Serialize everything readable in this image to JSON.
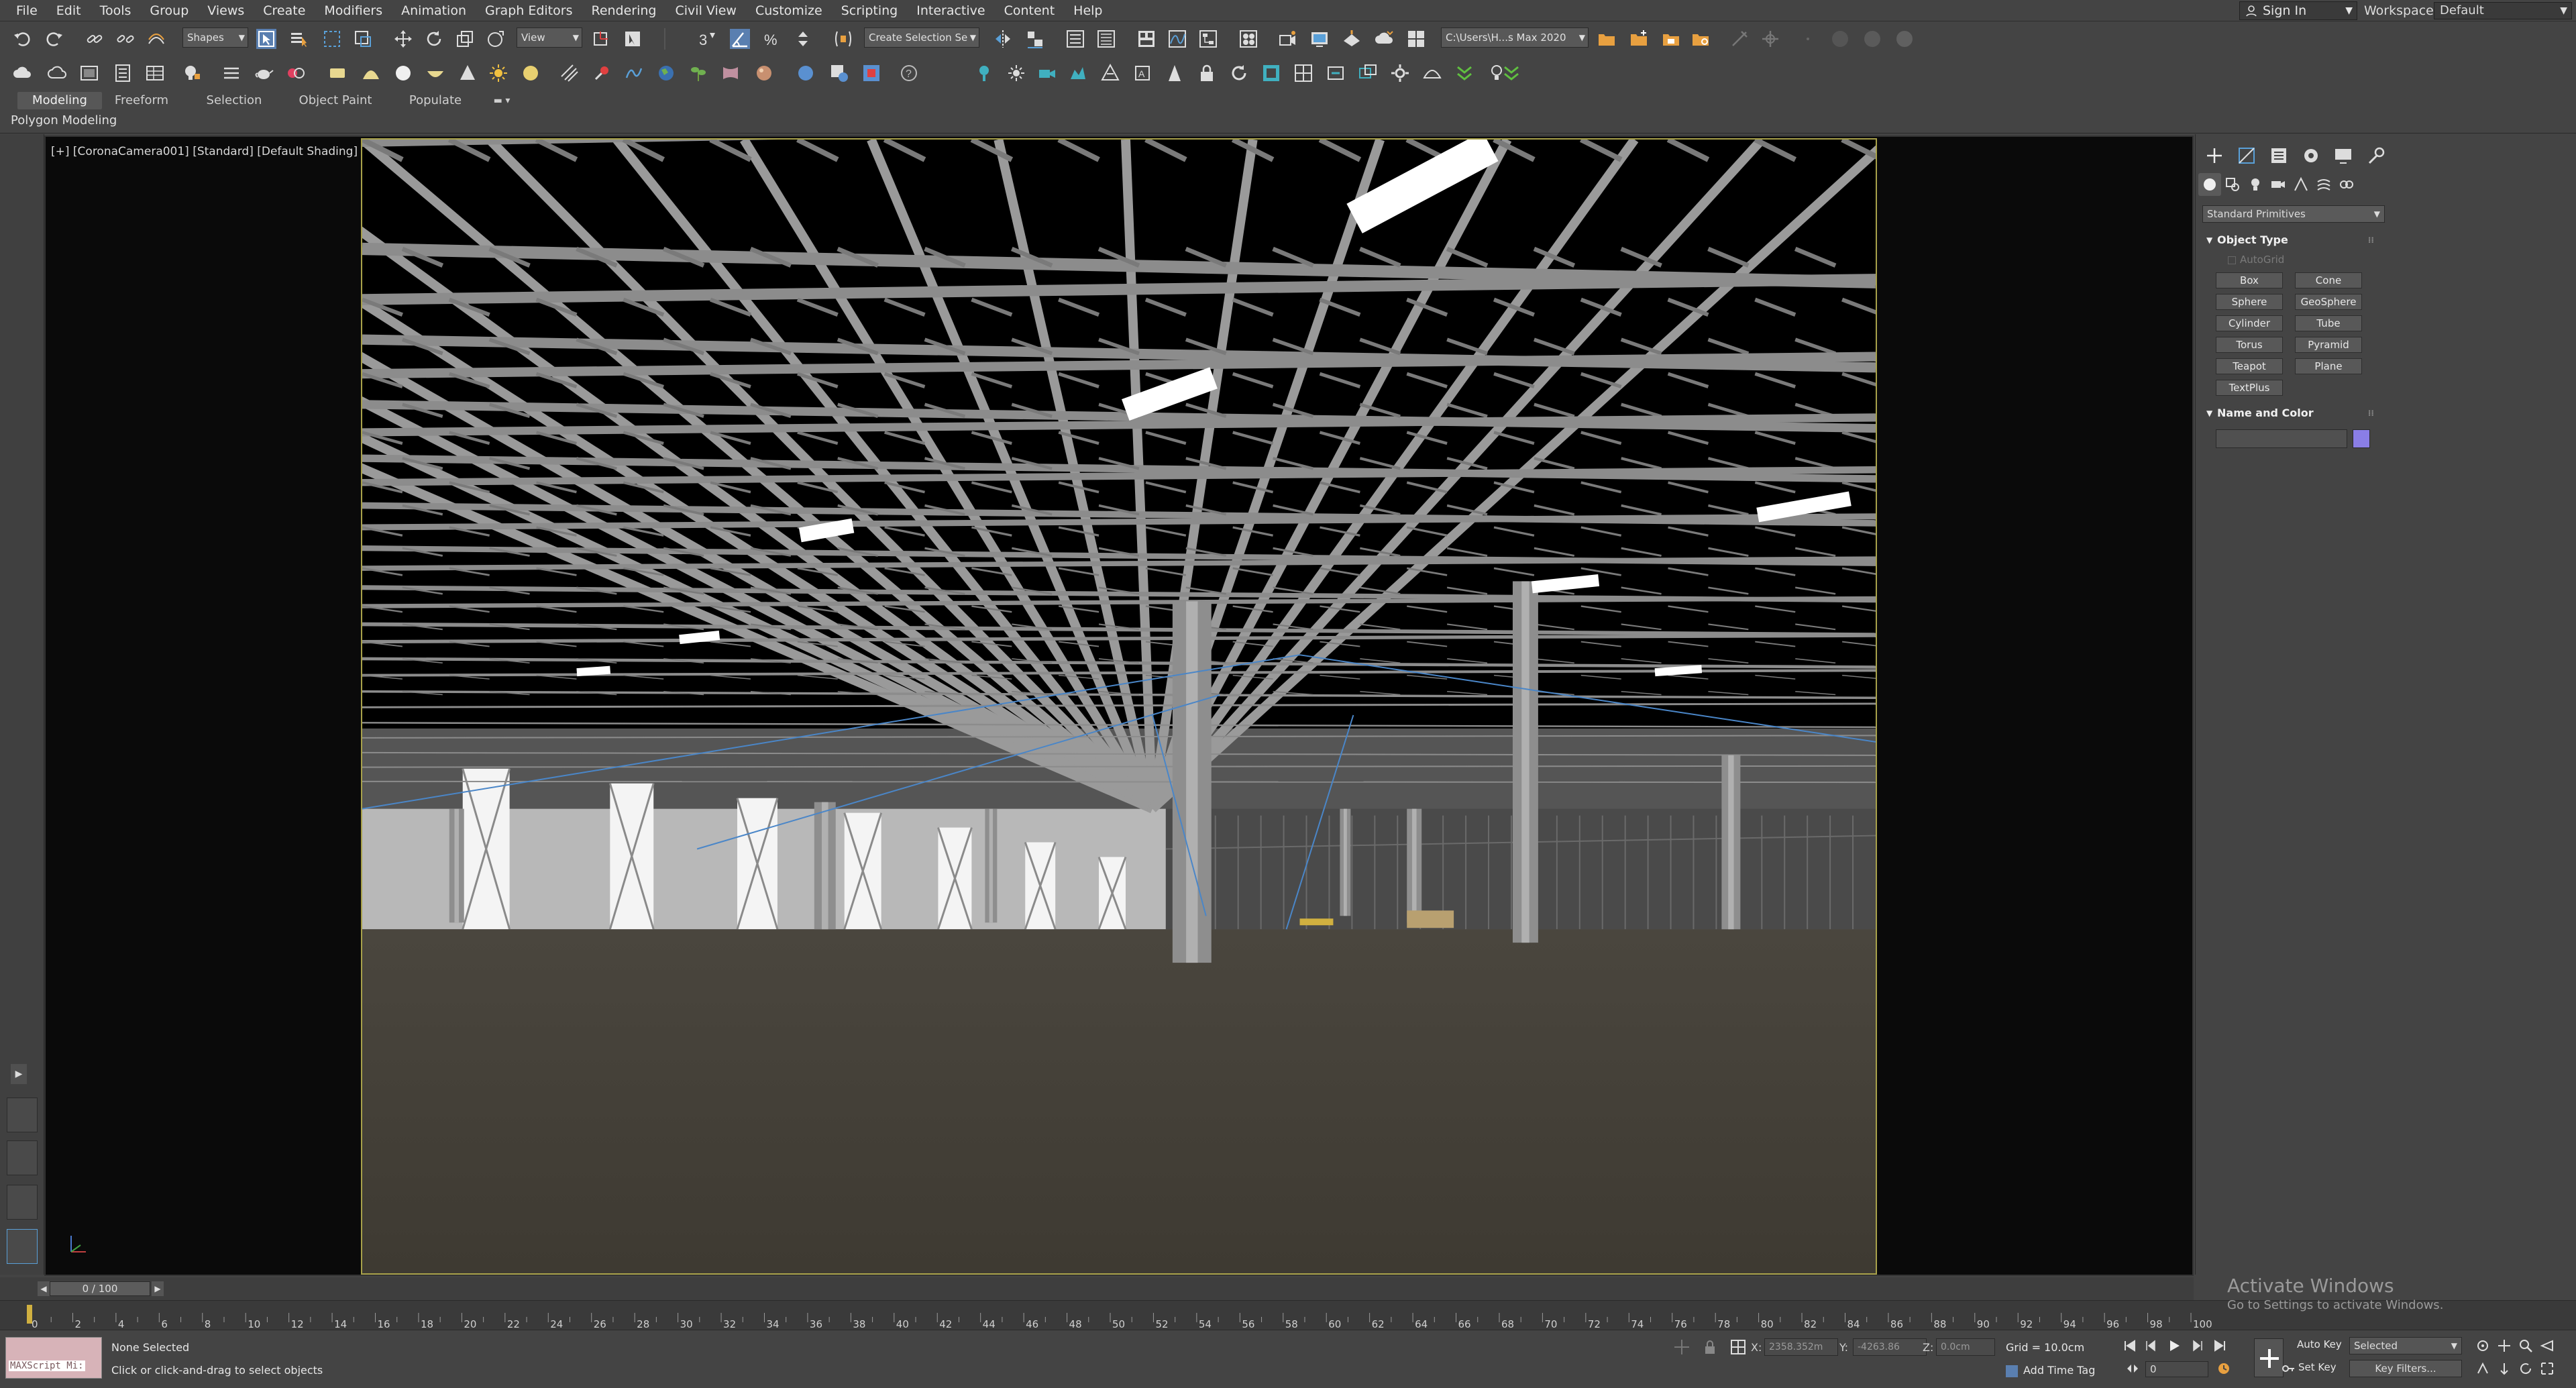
{
  "menubar": {
    "items": [
      "File",
      "Edit",
      "Tools",
      "Group",
      "Views",
      "Create",
      "Modifiers",
      "Animation",
      "Graph Editors",
      "Rendering",
      "Civil View",
      "Customize",
      "Scripting",
      "Interactive",
      "Content",
      "Help"
    ],
    "sign_in": "Sign In",
    "workspaces_label": "Workspaces:",
    "workspace_value": "Default"
  },
  "toolbar": {
    "selection_filter": "Shapes",
    "reference_coord": "View",
    "named_selection": "Create Selection Se",
    "project_path": "C:\\Users\\H...s Max 2020"
  },
  "ribbon": {
    "tabs": [
      "Modeling",
      "Freeform",
      "Selection",
      "Object Paint",
      "Populate"
    ],
    "active_tab": "Modeling",
    "panel_label": "Polygon Modeling"
  },
  "viewport": {
    "label": "[+] [CoronaCamera001] [Standard] [Default Shading]"
  },
  "command_panel": {
    "subtype": "Standard Primitives",
    "object_type_title": "Object Type",
    "autogrid_label": "AutoGrid",
    "object_buttons": [
      "Box",
      "Cone",
      "Sphere",
      "GeoSphere",
      "Cylinder",
      "Tube",
      "Torus",
      "Pyramid",
      "Teapot",
      "Plane",
      "TextPlus"
    ],
    "name_color_title": "Name and Color",
    "name_value": "",
    "object_color": "#8a7ee6"
  },
  "timeline": {
    "frame_display": "0 / 100",
    "ticks": [
      "0",
      "2",
      "4",
      "6",
      "8",
      "10",
      "12",
      "14",
      "16",
      "18",
      "20",
      "22",
      "24",
      "26",
      "28",
      "30",
      "32",
      "34",
      "36",
      "38",
      "40",
      "42",
      "44",
      "46",
      "48",
      "50",
      "52",
      "54",
      "56",
      "58",
      "60",
      "62",
      "64",
      "66",
      "68",
      "70",
      "72",
      "74",
      "76",
      "78",
      "80",
      "82",
      "84",
      "86",
      "88",
      "90",
      "92",
      "94",
      "96",
      "98",
      "100"
    ]
  },
  "status": {
    "maxscript_label": "MAXScript Mi:",
    "selection": "None Selected",
    "prompt": "Click or click-and-drag to select objects",
    "x_label": "X:",
    "x_value": "2358.352m",
    "y_label": "Y:",
    "y_value": "-4263.86",
    "z_label": "Z:",
    "z_value": "0.0cm",
    "grid": "Grid = 10.0cm",
    "add_time_tag": "Add Time Tag",
    "auto_key": "Auto Key",
    "set_key": "Set Key",
    "key_mode": "Selected",
    "key_filters": "Key Filters...",
    "current_frame": "0"
  },
  "watermark": {
    "title": "Activate Windows",
    "subtitle": "Go to Settings to activate Windows."
  },
  "colors": {
    "accent": "#5aa0d8",
    "viewport_frame": "#a8a14a",
    "ui_background": "#444444"
  }
}
